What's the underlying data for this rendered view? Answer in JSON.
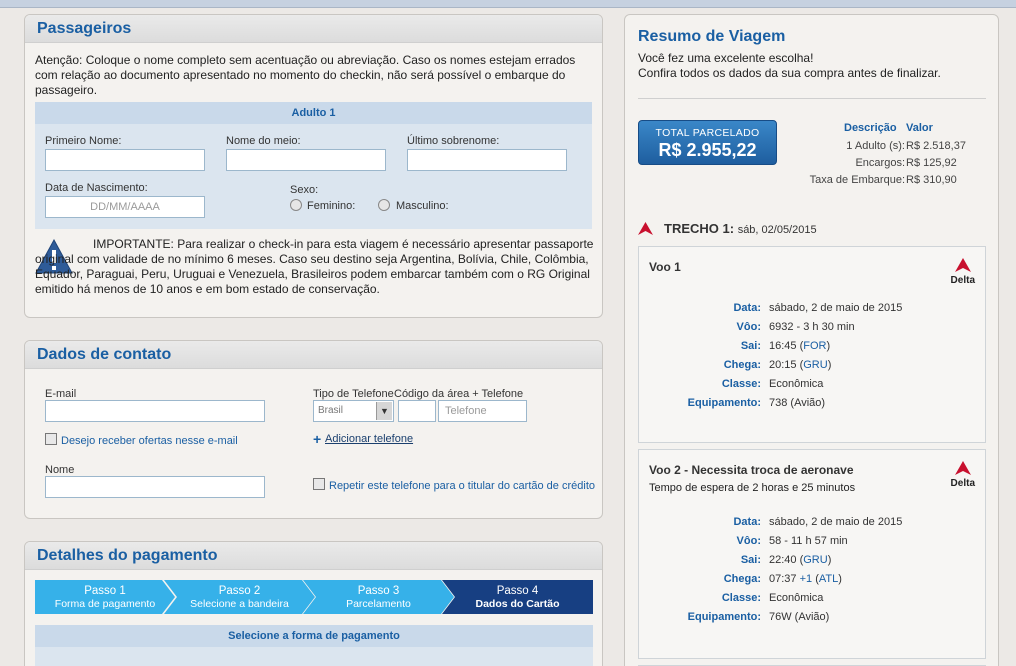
{
  "passengers": {
    "title": "Passageiros",
    "notice": "Atenção: Coloque o nome completo sem acentuação ou abreviação. Caso os nomes estejam errados com relação ao documento apresentado no momento do checkin, não será possível o embarque do passageiro.",
    "adult_title": "Adulto 1",
    "first_name_label": "Primeiro Nome:",
    "middle_name_label": "Nome do meio:",
    "last_name_label": "Último sobrenome:",
    "birth_label": "Data de Nascimento:",
    "birth_placeholder": "DD/MM/AAAA",
    "sex_label": "Sexo:",
    "female": "Feminino:",
    "male": "Masculino:",
    "important": "IMPORTANTE: Para realizar o check-in para esta viagem é necessário apresentar passaporte original com validade de no mínimo 6 meses. Caso seu destino seja Argentina, Bolívia, Chile, Colômbia, Equador, Paraguai, Peru, Uruguai e Venezuela, Brasileiros podem embarcar também com o RG Original emitido há menos de 10 anos e em bom estado de conservação."
  },
  "contact": {
    "title": "Dados de contato",
    "email_label": "E-mail",
    "offers_label": "Desejo receber ofertas nesse e-mail",
    "name_label": "Nome",
    "phone_type_label": "Tipo de Telefone",
    "area_phone_label": "Código da área + Telefone",
    "country_value": "Brasil",
    "phone_placeholder": "Telefone",
    "add_phone": "Adicionar telefone",
    "repeat_phone": "Repetir este telefone para o titular do cartão de crédito"
  },
  "payment": {
    "title": "Detalhes do pagamento",
    "steps": [
      {
        "num": "Passo 1",
        "label": "Forma de pagamento"
      },
      {
        "num": "Passo 2",
        "label": "Selecione a bandeira"
      },
      {
        "num": "Passo 3",
        "label": "Parcelamento"
      },
      {
        "num": "Passo 4",
        "label": "Dados do Cartão"
      }
    ],
    "select_title": "Selecione a forma de pagamento"
  },
  "summary": {
    "title": "Resumo de Viagem",
    "line1": "Você fez uma excelente escolha!",
    "line2": "Confira todos os dados da sua compra antes de finalizar.",
    "total_label": "TOTAL PARCELADO",
    "total_value": "R$ 2.955,22",
    "desc_head": "Descrição",
    "value_head": "Valor",
    "costs": [
      {
        "label": "1 Adulto (s):",
        "value": "R$ 2.518,37"
      },
      {
        "label": "Encargos:",
        "value": "R$ 125,92"
      },
      {
        "label": "Taxa de Embarque:",
        "value": "R$ 310,90"
      }
    ],
    "trecho_label": "TRECHO 1:",
    "trecho_date": "sáb, 02/05/2015",
    "airline": "Delta",
    "flights": [
      {
        "title": "Voo 1",
        "wait": "",
        "data": "sábado, 2 de maio de 2015",
        "voo": "6932 - 3 h 30 min",
        "sai_time": "16:45 (",
        "sai_code": "FOR",
        "chega_time": "20:15 (",
        "chega_code": "GRU",
        "classe": "Econômica",
        "equip": "738 (Avião)"
      },
      {
        "title": "Voo 2 - Necessita troca de aeronave",
        "wait": "Tempo de espera de 2 horas e 25 minutos",
        "data": "sábado, 2 de maio de 2015",
        "voo": "58 - 11 h 57 min",
        "sai_time": "22:40 (",
        "sai_code": "GRU",
        "chega_time": "07:37 ",
        "chega_extra": "+1",
        "chega_code": "ATL",
        "classe": "Econômica",
        "equip": "76W (Avião)"
      }
    ],
    "labels": {
      "data": "Data:",
      "voo": "Vôo:",
      "sai": "Sai:",
      "chega": "Chega:",
      "classe": "Classe:",
      "equip": "Equipamento:"
    }
  },
  "colors": {
    "accent": "#1a5fa3",
    "step_active": "#173f82",
    "step_inactive": "#36b1e9",
    "delta_red": "#c8102e"
  }
}
